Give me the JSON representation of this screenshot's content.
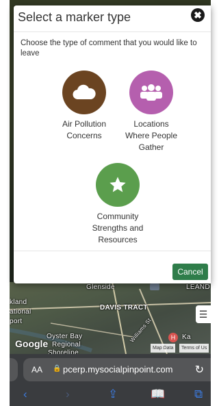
{
  "modal": {
    "title": "Select a marker type",
    "close_glyph": "✖",
    "description": "Choose the type of comment that you would like to leave",
    "cancel_label": "Cancel"
  },
  "markers": [
    {
      "label_line1": "Air Pollution",
      "label_line2": "Concerns",
      "label_line3": "",
      "icon": "cloud-icon",
      "color": "#6b4421"
    },
    {
      "label_line1": "Locations",
      "label_line2": "Where People",
      "label_line3": "Gather",
      "icon": "group-icon",
      "color": "#b55fae"
    },
    {
      "label_line1": "Community",
      "label_line2": "Strengths and",
      "label_line3": "Resources",
      "icon": "star-icon",
      "color": "#5b9e4d"
    }
  ],
  "map": {
    "labels": {
      "oleside": "Glenside",
      "davis_tract": "DAVIS TRACT",
      "kland": "kland",
      "national": "ational",
      "port": "port",
      "oyster_bay": "Oyster Bay",
      "regional": "Regional",
      "shoreline": "Shoreline",
      "leand": "LEAND",
      "williams": "Williams St",
      "ka": "Ka"
    },
    "google": "Google",
    "map_data": "Map Data",
    "terms": "Terms of Us"
  },
  "browser": {
    "aa": "AA",
    "url": "pcerp.mysocialpinpoint.com"
  }
}
